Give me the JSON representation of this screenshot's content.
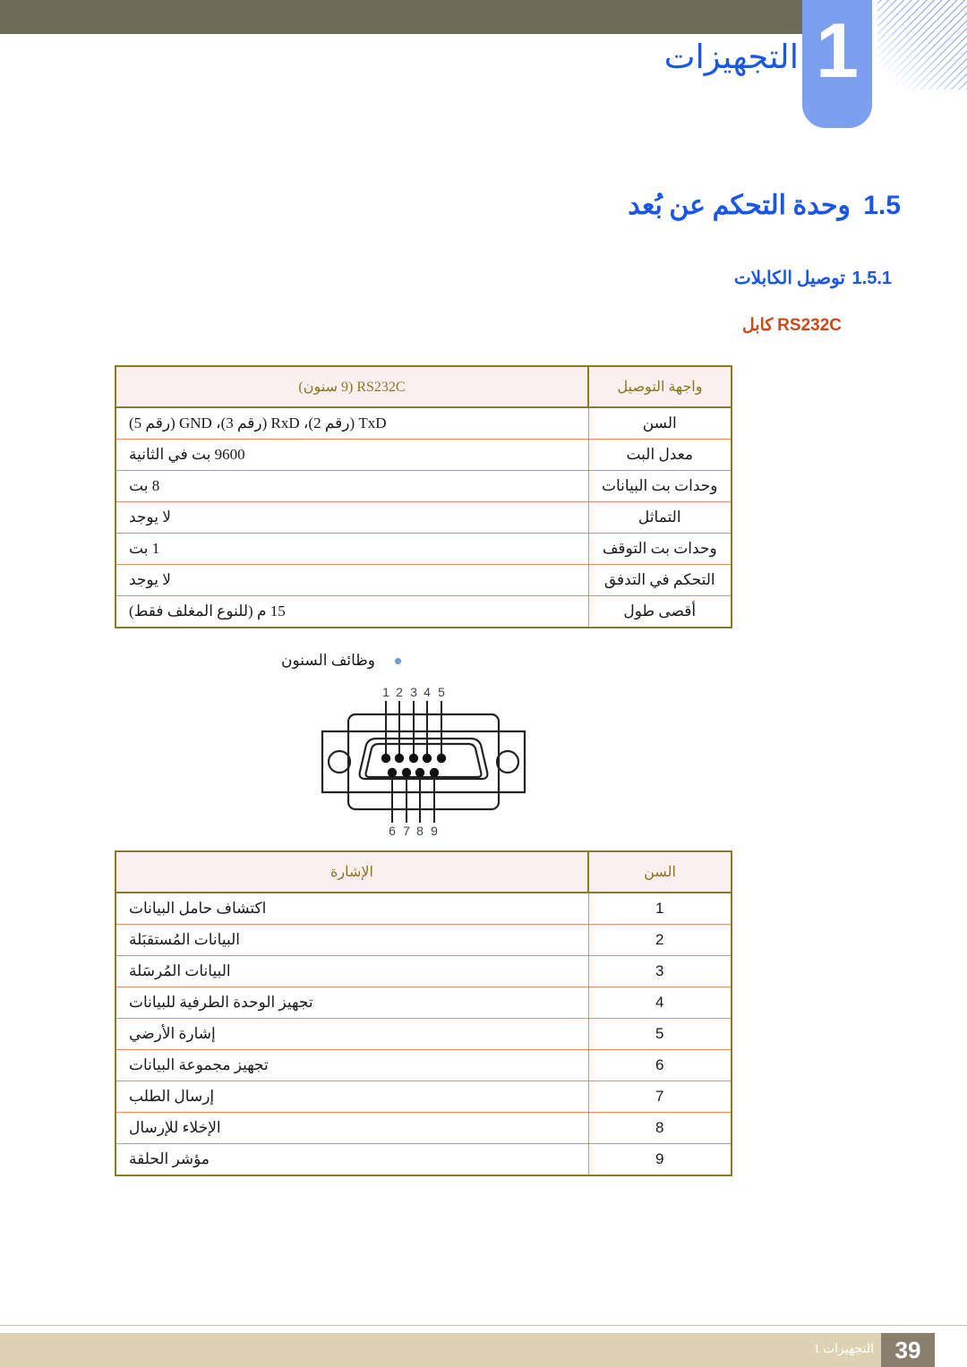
{
  "document": {
    "chapter_title": "التجهيزات",
    "chapter_number": "1"
  },
  "headings": {
    "h1_number": "1.5",
    "h1_text": "وحدة التحكم عن بُعد",
    "h2_number": "1.5.1",
    "h2_text": "توصيل الكابلات",
    "h3_text_ar": "كابل",
    "h3_text_ltr": "RS232C"
  },
  "spec_table": {
    "header_label": "واجهة التوصيل",
    "header_value": "RS232C (9 سنون)",
    "rows": [
      {
        "label": "السن",
        "value": "TxD (رقم 2)، RxD (رقم 3)، GND (رقم 5)"
      },
      {
        "label": "معدل البت",
        "value": "9600 بت في الثانية"
      },
      {
        "label": "وحدات بت البيانات",
        "value": "8 بت"
      },
      {
        "label": "التماثل",
        "value": "لا يوجد"
      },
      {
        "label": "وحدات بت التوقف",
        "value": "1 بت"
      },
      {
        "label": "التحكم في التدفق",
        "value": "لا يوجد"
      },
      {
        "label": "أقصى طول",
        "value": "15 م (للنوع المغلف فقط)"
      }
    ]
  },
  "bullet": {
    "text": "وظائف السنون"
  },
  "connector": {
    "name": "d-sub-9-pin-connector",
    "top_pins": [
      "1",
      "2",
      "3",
      "4",
      "5"
    ],
    "bottom_pins": [
      "6",
      "7",
      "8",
      "9"
    ]
  },
  "pin_table": {
    "header_pin": "السن",
    "header_signal": "الإشارة",
    "rows": [
      {
        "pin": "1",
        "signal": "اكتشاف حامل البيانات"
      },
      {
        "pin": "2",
        "signal": "البيانات المُستقبَلة"
      },
      {
        "pin": "3",
        "signal": "البيانات المُرسَلة"
      },
      {
        "pin": "4",
        "signal": "تجهيز الوحدة الطرفية للبيانات"
      },
      {
        "pin": "5",
        "signal": "إشارة الأرضي"
      },
      {
        "pin": "6",
        "signal": "تجهيز مجموعة البيانات"
      },
      {
        "pin": "7",
        "signal": "إرسال الطلب"
      },
      {
        "pin": "8",
        "signal": "الإخلاء للإرسال"
      },
      {
        "pin": "9",
        "signal": "مؤشر الحلقة"
      }
    ]
  },
  "footer": {
    "text": "التجهيزات 1",
    "page_number": "39"
  },
  "colors": {
    "heading_blue": "#1a56e8",
    "accent_orange": "#cc4a1a",
    "table_border": "#897a2a",
    "table_divider": "#e88a66",
    "table_header_bg": "#fbf0ef",
    "top_bar": "#6d6b56",
    "tab_blue": "#7c9ff0",
    "footer_bar": "#ddd2b4",
    "footer_page_bg": "#8a7f6c"
  }
}
